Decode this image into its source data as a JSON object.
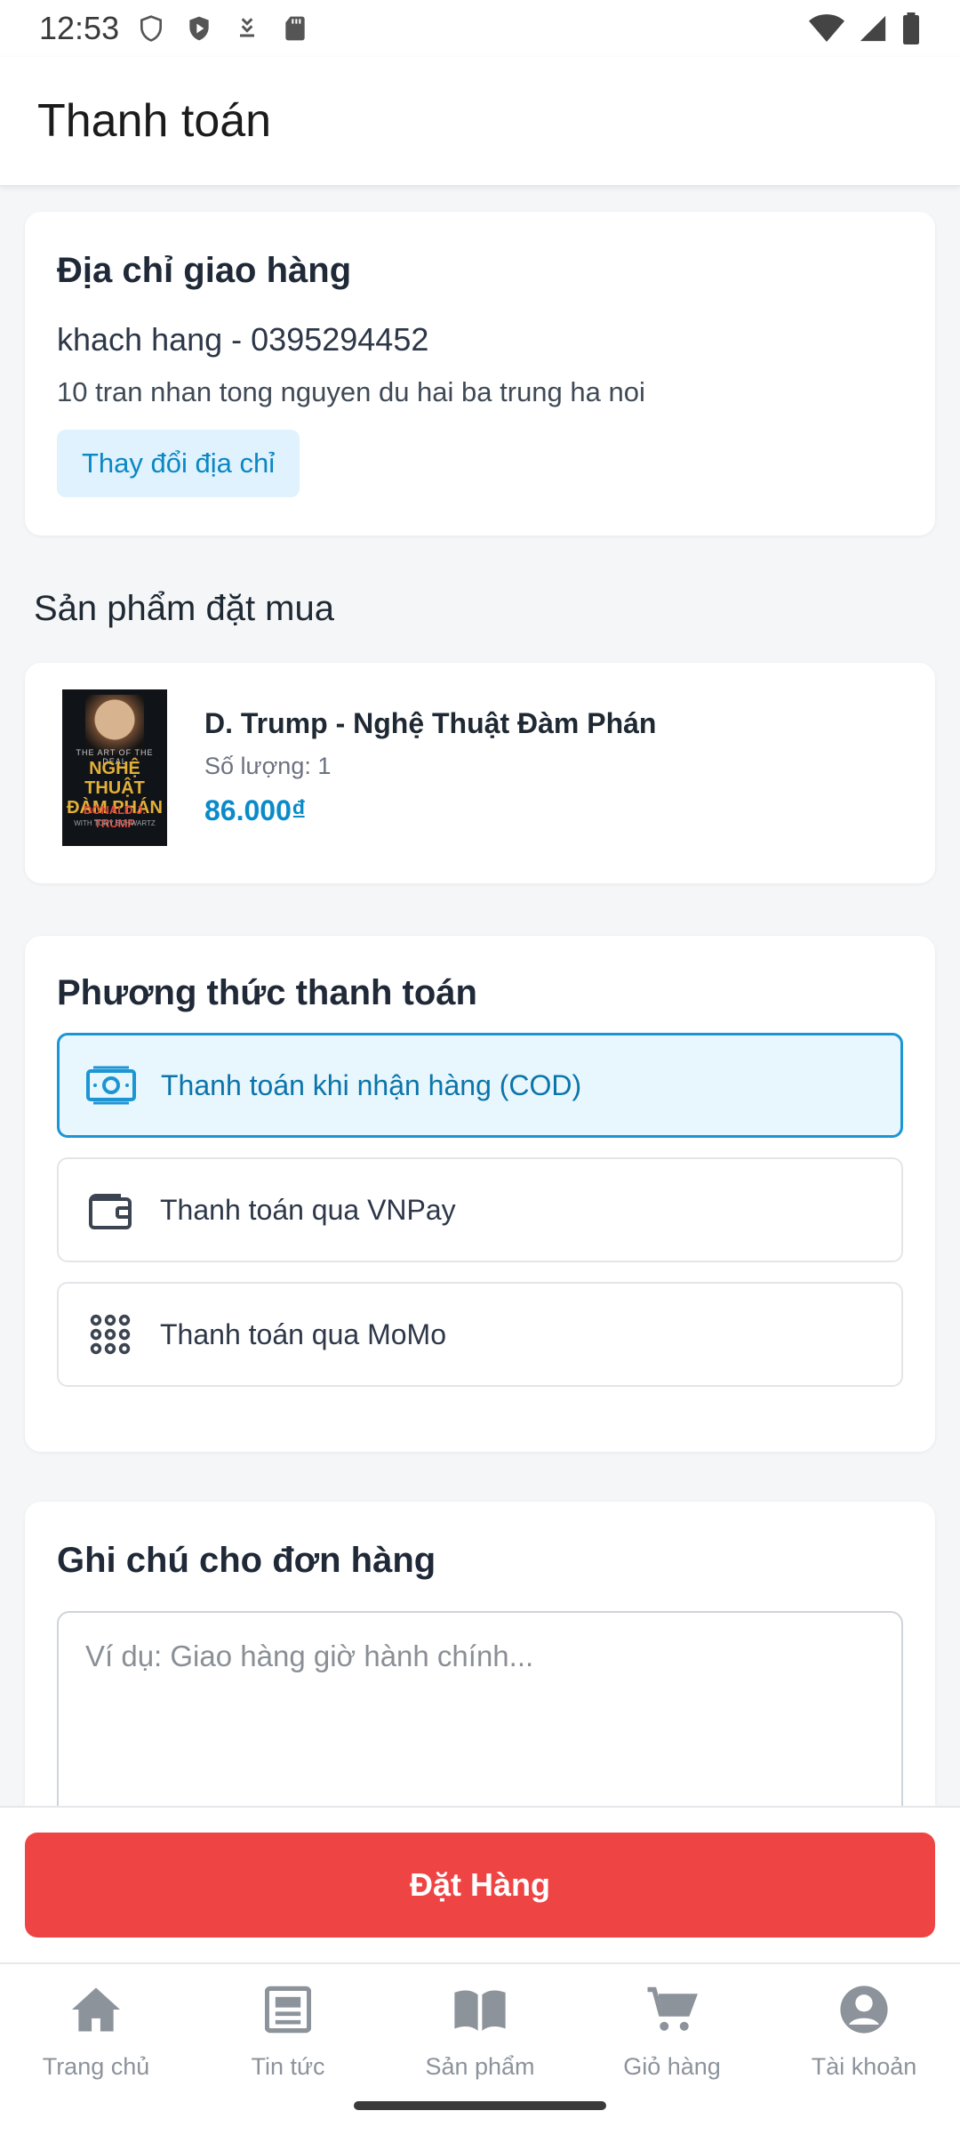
{
  "status_bar": {
    "time": "12:53",
    "icons_left": [
      "shield-outline-icon",
      "shield-play-icon",
      "download-icon",
      "sd-card-icon"
    ],
    "icons_right": [
      "wifi-icon",
      "signal-icon",
      "battery-icon"
    ]
  },
  "app_bar": {
    "title": "Thanh toán"
  },
  "address": {
    "title": "Địa chỉ giao hàng",
    "name_phone": "khach hang - 0395294452",
    "line": "10 tran nhan tong nguyen du hai ba trung ha noi",
    "change_button": "Thay đổi địa chỉ"
  },
  "products": {
    "title": "Sản phẩm đặt mua",
    "items": [
      {
        "name": "D. Trump - Nghệ Thuật Đàm Phán",
        "quantity": "Số lượng: 1",
        "price": "86.000₫",
        "cover": {
          "line1": "THE ART OF THE DEAL",
          "line2": "NGHỆ THUẬT ĐÀM PHÁN",
          "line3": "DONALD J. TRUMP",
          "line4": "WITH TONY SCHWARTZ"
        }
      }
    ]
  },
  "payment": {
    "title": "Phương thức thanh toán",
    "selected_index": 0,
    "options": [
      {
        "label": "Thanh toán khi nhận hàng (COD)",
        "icon": "cash-icon"
      },
      {
        "label": "Thanh toán qua VNPay",
        "icon": "wallet-icon"
      },
      {
        "label": "Thanh toán qua MoMo",
        "icon": "dots-grid-icon"
      }
    ]
  },
  "note": {
    "title": "Ghi chú cho đơn hàng",
    "placeholder": "Ví dụ: Giao hàng giờ hành chính..."
  },
  "order_button": "Đặt Hàng",
  "bottom_nav": [
    {
      "label": "Trang chủ",
      "icon": "home-icon"
    },
    {
      "label": "Tin tức",
      "icon": "news-icon"
    },
    {
      "label": "Sản phẩm",
      "icon": "book-icon"
    },
    {
      "label": "Giỏ hàng",
      "icon": "cart-icon"
    },
    {
      "label": "Tài khoản",
      "icon": "account-icon"
    }
  ],
  "colors": {
    "accent": "#0b87c4",
    "order_button": "#ef4444",
    "selected_border": "#1c95d4",
    "selected_bg": "#e8f6fd"
  }
}
